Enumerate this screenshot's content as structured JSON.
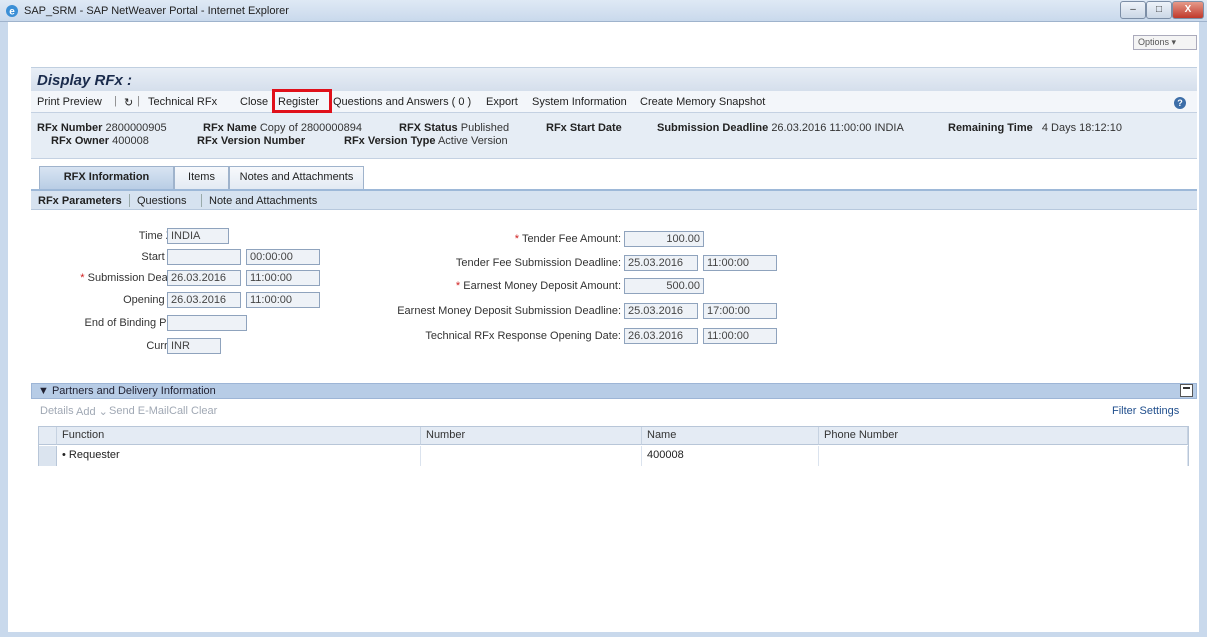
{
  "window": {
    "title": "SAP_SRM - SAP NetWeaver Portal - Internet Explorer",
    "min_glyph": "–",
    "max_glyph": "□",
    "close_glyph": "X"
  },
  "options_label": "Options ▾",
  "page": {
    "title": "Display RFx :"
  },
  "toolbar": {
    "print_preview": "Print Preview",
    "refresh_glyph": "↻",
    "technical_rfx": "Technical RFx",
    "close": "Close",
    "register": "Register",
    "questions_answers": "Questions and Answers ( 0 )",
    "export": "Export",
    "system_information": "System Information",
    "create_memory_snapshot": "Create Memory Snapshot",
    "help_glyph": "?"
  },
  "header": {
    "rfx_number_label": "RFx Number",
    "rfx_number": "2800000905",
    "rfx_name_label": "RFx Name",
    "rfx_name": "Copy of 2800000894",
    "rfx_status_label": "RFX Status",
    "rfx_status": "Published",
    "rfx_start_date_label": "RFx Start Date",
    "submission_deadline_label": "Submission Deadline",
    "submission_deadline": "26.03.2016 11:00:00 INDIA",
    "remaining_time_label": "Remaining Time",
    "remaining_time": "4 Days 18:12:10",
    "rfx_owner_label": "RFx Owner",
    "rfx_owner": "400008",
    "rfx_version_number_label": "RFx Version Number",
    "rfx_version_type_label": "RFx Version Type",
    "rfx_version_type": "Active Version"
  },
  "tabs": [
    {
      "label": "RFX Information"
    },
    {
      "label": "Items"
    },
    {
      "label": "Notes and Attachments"
    }
  ],
  "subtabs": [
    {
      "label": "RFx Parameters"
    },
    {
      "label": "Questions"
    },
    {
      "label": "Note and Attachments"
    }
  ],
  "form_left": {
    "time_zone_label": "Time Zone:",
    "time_zone": "INDIA",
    "start_date_label": "Start Date:",
    "start_date": "",
    "start_time": "00:00:00",
    "submission_deadline_label": "Submission Deadline:",
    "submission_date": "26.03.2016",
    "submission_time": "11:00:00",
    "opening_date_label": "Opening Date:",
    "opening_date": "26.03.2016",
    "opening_time": "11:00:00",
    "end_binding_label": "End of Binding Period:",
    "end_binding": "",
    "currency_label": "Currency:",
    "currency": "INR",
    "required_mark": "*"
  },
  "form_right": {
    "tender_fee_amount_label": "Tender Fee Amount:",
    "tender_fee_amount": "100.00",
    "tender_fee_deadline_label": "Tender Fee Submission Deadline:",
    "tender_fee_date": "25.03.2016",
    "tender_fee_time": "11:00:00",
    "emd_amount_label": "Earnest Money Deposit Amount:",
    "emd_amount": "500.00",
    "emd_deadline_label": "Earnest Money Deposit Submission Deadline:",
    "emd_date": "25.03.2016",
    "emd_time": "17:00:00",
    "tech_opening_label": "Technical RFx Response Opening Date:",
    "tech_opening_date": "26.03.2016",
    "tech_opening_time": "11:00:00",
    "required_mark": "*"
  },
  "partners": {
    "section_title": "▼ Partners and Delivery Information",
    "details": "Details",
    "add": "Add ⌄",
    "send_email": "Send E-Mail",
    "call": "Call",
    "clear": "Clear",
    "filter_settings": "Filter Settings",
    "columns": [
      "Function",
      "Number",
      "Name",
      "Phone Number"
    ],
    "rows": [
      {
        "function": "•  Requester",
        "number": "",
        "name": "400008",
        "phone": ""
      }
    ]
  }
}
